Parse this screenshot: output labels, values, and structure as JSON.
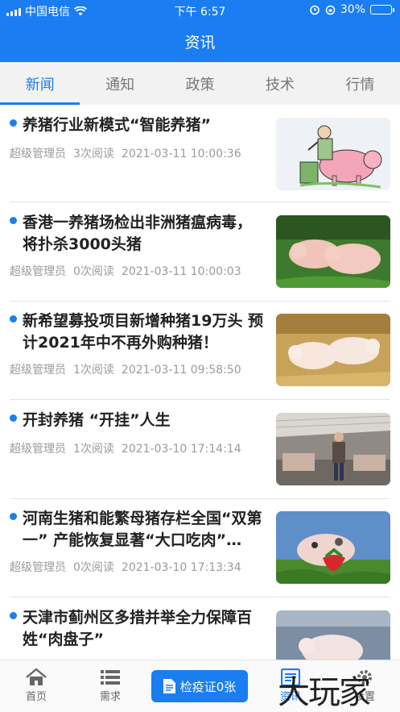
{
  "status_bar": {
    "carrier": "中国电信",
    "time": "下午 6:57",
    "battery": "30%",
    "battery_level": 0.3
  },
  "header": {
    "title": "资讯"
  },
  "tabs": [
    {
      "label": "新闻",
      "active": true
    },
    {
      "label": "通知",
      "active": false
    },
    {
      "label": "政策",
      "active": false
    },
    {
      "label": "技术",
      "active": false
    },
    {
      "label": "行情",
      "active": false
    }
  ],
  "news": [
    {
      "title": "养猪行业新模式“智能养猪”",
      "author": "超级管理员",
      "reads": "3次阅读",
      "date": "2021-03-11 10:00:36",
      "image": "farmer-feeding-pig-cartoon"
    },
    {
      "title": "香港一养猪场检出非洲猪瘟病毒，将扑杀3000头猪",
      "author": "超级管理员",
      "reads": "0次阅读",
      "date": "2021-03-11 10:00:03",
      "image": "piglets-on-grass"
    },
    {
      "title": "新希望募投项目新增种猪19万头 预计2021年中不再外购种猪！",
      "author": "超级管理员",
      "reads": "1次阅读",
      "date": "2021-03-11 09:58:50",
      "image": "piglets-on-straw"
    },
    {
      "title": "开封养猪 “开挂”人生",
      "author": "超级管理员",
      "reads": "1次阅读",
      "date": "2021-03-10 17:14:14",
      "image": "man-in-pig-barn"
    },
    {
      "title": "河南生猪和能繁母猪存栏全国“双第一” 产能恢复显著“大口吃肉”…",
      "author": "超级管理员",
      "reads": "0次阅读",
      "date": "2021-03-10 17:13:34",
      "image": "piglet-with-strawberry"
    },
    {
      "title": "天津市蓟州区多措并举全力保障百姓“肉盘子”",
      "author": "",
      "reads": "",
      "date": "",
      "image": "piglet-in-pen"
    }
  ],
  "bottom_nav": {
    "home": "首页",
    "demand": "需求",
    "cert_button": "检疫证0张",
    "news": "资讯",
    "settings": "设置"
  },
  "watermark": "大玩家",
  "colors": {
    "primary": "#1a7df2",
    "title_text": "#222222",
    "meta_text": "#9a9a9a",
    "tab_bg": "#f2f2f2"
  }
}
